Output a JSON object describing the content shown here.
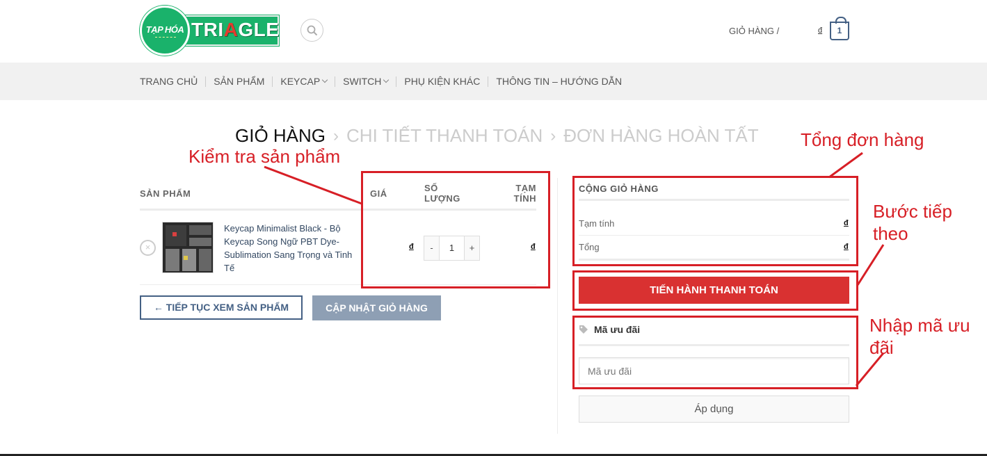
{
  "header": {
    "logo": {
      "circle_text": "TẠP HÓA",
      "bar_text_a": "TRI",
      "bar_text_b": "A",
      "bar_text_c": "GLE"
    },
    "cart_link": "GIỎ HÀNG /",
    "cart_currency": "đ",
    "cart_count": "1"
  },
  "nav": {
    "items": [
      {
        "label": "TRANG CHỦ"
      },
      {
        "label": "SẢN PHẨM"
      },
      {
        "label": "KEYCAP"
      },
      {
        "label": "SWITCH"
      },
      {
        "label": "PHỤ KIỆN KHÁC"
      },
      {
        "label": "THÔNG TIN – HƯỚNG DẪN"
      }
    ]
  },
  "steps": {
    "cart": "GIỎ HÀNG",
    "checkout": "CHI TIẾT THANH TOÁN",
    "complete": "ĐƠN HÀNG HOÀN TẤT",
    "separator": "›"
  },
  "cart_table": {
    "headers": {
      "product": "SẢN PHẨM",
      "price": "GIÁ",
      "quantity_1": "SỐ",
      "quantity_2": "LƯỢNG",
      "subtotal_1": "TẠM",
      "subtotal_2": "TÍNH"
    },
    "item": {
      "remove": "×",
      "name": "Keycap Minimalist Black - Bộ Keycap Song Ngữ PBT Dye-Sublimation Sang Trọng và Tinh Tế",
      "price": "đ",
      "qty_minus": "-",
      "qty_value": "1",
      "qty_plus": "+",
      "subtotal": "đ"
    },
    "continue_button": "← TIẾP TỤC XEM SẢN PHẨM",
    "update_button": "CẬP NHẬT GIỎ HÀNG"
  },
  "totals": {
    "title": "CỘNG GIỎ HÀNG",
    "subtotal_label": "Tạm tính",
    "subtotal_value": "đ",
    "total_label": "Tổng",
    "total_value": "đ",
    "checkout_button": "TIẾN HÀNH THANH TOÁN"
  },
  "coupon": {
    "icon": "tag-icon",
    "heading": "Mã ưu đãi",
    "placeholder": "Mã ưu đãi",
    "apply_button": "Áp dụng"
  },
  "annotations": {
    "check_products": "Kiểm tra sản phẩm",
    "order_total": "Tổng đơn hàng",
    "next_step_1": "Bước tiếp",
    "next_step_2": "theo",
    "coupon_1": "Nhập mã ưu",
    "coupon_2": "đãi"
  },
  "colors": {
    "accent": "#446084",
    "checkout": "#d93131",
    "annotation": "#d71f26",
    "logo_green": "#1ab26b"
  }
}
